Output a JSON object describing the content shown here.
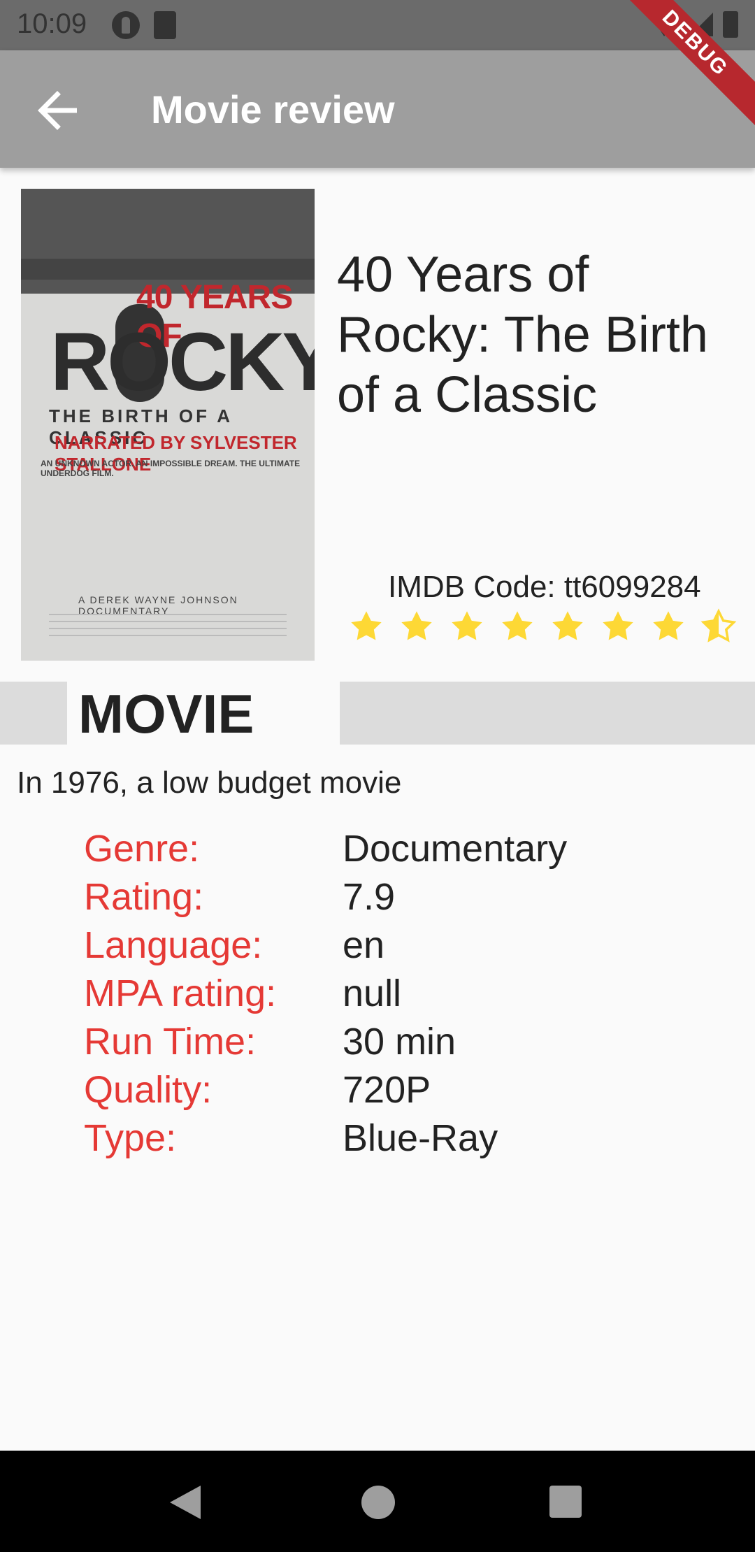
{
  "status_bar": {
    "time": "10:09",
    "icons": [
      "app-circle-icon",
      "sd-card-icon",
      "wifi-icon",
      "signal-icon",
      "battery-icon"
    ]
  },
  "app_bar": {
    "title": "Movie review",
    "back_icon": "arrow-back-icon",
    "debug_label": "DEBUG",
    "bg_color": "#9e9e9e"
  },
  "poster": {
    "years_text": "40 YEARS OF",
    "rocky_text": "ROCKY",
    "birth_text": "THE BIRTH OF A CLASSIC",
    "narrated_text": "NARRATED BY SYLVESTER STALLONE",
    "tagline_text": "AN UNKNOWN ACTOR. AN IMPOSSIBLE DREAM. THE ULTIMATE UNDERDOG FILM.",
    "credit_text": "A DEREK WAYNE JOHNSON DOCUMENTARY"
  },
  "movie": {
    "title": "40 Years of Rocky: The Birth of a Classic",
    "imdb_code": "IMDB Code: tt6099284",
    "rating_stars": 7.9,
    "max_stars": 10,
    "star_color": "#fdd835"
  },
  "section": {
    "label": "MOVIE"
  },
  "description": "In 1976, a low budget movie",
  "info": [
    {
      "key": "Genre:",
      "value": "Documentary"
    },
    {
      "key": "Rating:",
      "value": "7.9"
    },
    {
      "key": "Language:",
      "value": "en"
    },
    {
      "key": "MPA rating:",
      "value": "null"
    },
    {
      "key": "Run Time:",
      "value": "30 min"
    },
    {
      "key": "Quality:",
      "value": "720P"
    },
    {
      "key": "Type:",
      "value": "Blue-Ray"
    }
  ],
  "colors": {
    "key_color": "#e53935",
    "section_bar": "#dcdcdc"
  },
  "nav_bar": {
    "icons": [
      "nav-back-icon",
      "nav-home-icon",
      "nav-recents-icon"
    ]
  }
}
